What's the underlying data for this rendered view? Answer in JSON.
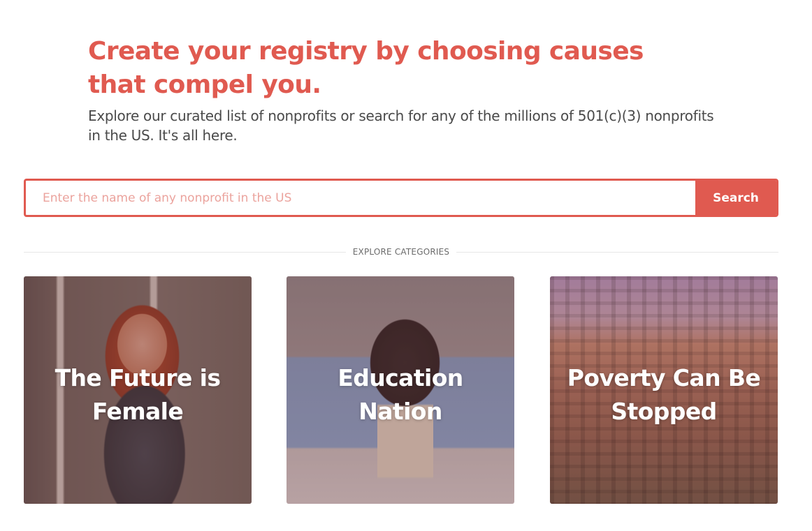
{
  "header": {
    "title": "Create your registry by choosing causes that compel you.",
    "subtitle": "Explore our curated list of nonprofits or search for any of the millions of 501(c)(3) nonprofits in the US. It's all here."
  },
  "search": {
    "placeholder": "Enter the name of any nonprofit in the US",
    "value": "",
    "button_label": "Search"
  },
  "categories": {
    "section_label": "EXPLORE CATEGORIES",
    "items": [
      {
        "title": "The Future is\nFemale"
      },
      {
        "title": "Education\nNation"
      },
      {
        "title": "Poverty Can Be\nStopped"
      }
    ]
  },
  "colors": {
    "accent": "#e05a50",
    "text": "#4a4a4a",
    "placeholder": "#eba39d"
  }
}
